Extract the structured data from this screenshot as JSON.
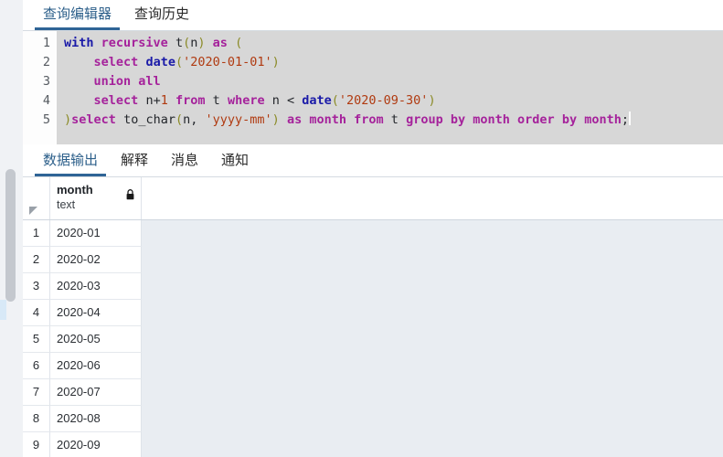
{
  "top_tabs": [
    {
      "label": "查询编辑器",
      "active": true
    },
    {
      "label": "查询历史",
      "active": false
    }
  ],
  "editor": {
    "line_numbers": [
      "1",
      "2",
      "3",
      "4",
      "5"
    ],
    "lines": [
      [
        {
          "t": "with",
          "c": "k-blue"
        },
        {
          "t": " ",
          "c": "k-plain"
        },
        {
          "t": "recursive",
          "c": "k-mag"
        },
        {
          "t": " ",
          "c": "k-plain"
        },
        {
          "t": "t",
          "c": "k-plain"
        },
        {
          "t": "(",
          "c": "k-paren"
        },
        {
          "t": "n",
          "c": "k-plain"
        },
        {
          "t": ")",
          "c": "k-paren"
        },
        {
          "t": " ",
          "c": "k-plain"
        },
        {
          "t": "as",
          "c": "k-mag"
        },
        {
          "t": " ",
          "c": "k-plain"
        },
        {
          "t": "(",
          "c": "k-paren"
        }
      ],
      [
        {
          "t": "    ",
          "c": "k-plain"
        },
        {
          "t": "select",
          "c": "k-mag"
        },
        {
          "t": " ",
          "c": "k-plain"
        },
        {
          "t": "date",
          "c": "k-blue"
        },
        {
          "t": "(",
          "c": "k-paren"
        },
        {
          "t": "'2020-01-01'",
          "c": "k-str"
        },
        {
          "t": ")",
          "c": "k-paren"
        }
      ],
      [
        {
          "t": "    ",
          "c": "k-plain"
        },
        {
          "t": "union",
          "c": "k-mag"
        },
        {
          "t": " ",
          "c": "k-plain"
        },
        {
          "t": "all",
          "c": "k-mag"
        }
      ],
      [
        {
          "t": "    ",
          "c": "k-plain"
        },
        {
          "t": "select",
          "c": "k-mag"
        },
        {
          "t": " ",
          "c": "k-plain"
        },
        {
          "t": "n",
          "c": "k-plain"
        },
        {
          "t": "+",
          "c": "k-plain"
        },
        {
          "t": "1",
          "c": "k-num"
        },
        {
          "t": " ",
          "c": "k-plain"
        },
        {
          "t": "from",
          "c": "k-mag"
        },
        {
          "t": " ",
          "c": "k-plain"
        },
        {
          "t": "t",
          "c": "k-plain"
        },
        {
          "t": " ",
          "c": "k-plain"
        },
        {
          "t": "where",
          "c": "k-mag"
        },
        {
          "t": " ",
          "c": "k-plain"
        },
        {
          "t": "n",
          "c": "k-plain"
        },
        {
          "t": " < ",
          "c": "k-plain"
        },
        {
          "t": "date",
          "c": "k-blue"
        },
        {
          "t": "(",
          "c": "k-paren"
        },
        {
          "t": "'2020-09-30'",
          "c": "k-str"
        },
        {
          "t": ")",
          "c": "k-paren"
        }
      ],
      [
        {
          "t": ")",
          "c": "k-paren"
        },
        {
          "t": "select",
          "c": "k-mag"
        },
        {
          "t": " ",
          "c": "k-plain"
        },
        {
          "t": "to_char",
          "c": "k-plain"
        },
        {
          "t": "(",
          "c": "k-paren"
        },
        {
          "t": "n",
          "c": "k-plain"
        },
        {
          "t": ", ",
          "c": "k-plain"
        },
        {
          "t": "'yyyy-mm'",
          "c": "k-str"
        },
        {
          "t": ")",
          "c": "k-paren"
        },
        {
          "t": " ",
          "c": "k-plain"
        },
        {
          "t": "as",
          "c": "k-mag"
        },
        {
          "t": " ",
          "c": "k-plain"
        },
        {
          "t": "month",
          "c": "k-mag"
        },
        {
          "t": " ",
          "c": "k-plain"
        },
        {
          "t": "from",
          "c": "k-mag"
        },
        {
          "t": " ",
          "c": "k-plain"
        },
        {
          "t": "t",
          "c": "k-plain"
        },
        {
          "t": " ",
          "c": "k-plain"
        },
        {
          "t": "group",
          "c": "k-mag"
        },
        {
          "t": " ",
          "c": "k-plain"
        },
        {
          "t": "by",
          "c": "k-mag"
        },
        {
          "t": " ",
          "c": "k-plain"
        },
        {
          "t": "month",
          "c": "k-mag"
        },
        {
          "t": " ",
          "c": "k-plain"
        },
        {
          "t": "order",
          "c": "k-mag"
        },
        {
          "t": " ",
          "c": "k-plain"
        },
        {
          "t": "by",
          "c": "k-mag"
        },
        {
          "t": " ",
          "c": "k-plain"
        },
        {
          "t": "month",
          "c": "k-mag"
        },
        {
          "t": ";",
          "c": "k-plain"
        }
      ]
    ]
  },
  "lower_tabs": [
    {
      "label": "数据输出",
      "active": true
    },
    {
      "label": "解释",
      "active": false
    },
    {
      "label": "消息",
      "active": false
    },
    {
      "label": "通知",
      "active": false
    }
  ],
  "grid": {
    "column": {
      "name": "month",
      "type": "text",
      "lock_icon": "lock-icon"
    },
    "rows": [
      {
        "n": "1",
        "month": "2020-01"
      },
      {
        "n": "2",
        "month": "2020-02"
      },
      {
        "n": "3",
        "month": "2020-03"
      },
      {
        "n": "4",
        "month": "2020-04"
      },
      {
        "n": "5",
        "month": "2020-05"
      },
      {
        "n": "6",
        "month": "2020-06"
      },
      {
        "n": "7",
        "month": "2020-07"
      },
      {
        "n": "8",
        "month": "2020-08"
      },
      {
        "n": "9",
        "month": "2020-09"
      }
    ]
  },
  "colors": {
    "accent": "#2f6496",
    "editor_bg": "#d7d7d7",
    "grid_bg": "#e9edf2"
  }
}
